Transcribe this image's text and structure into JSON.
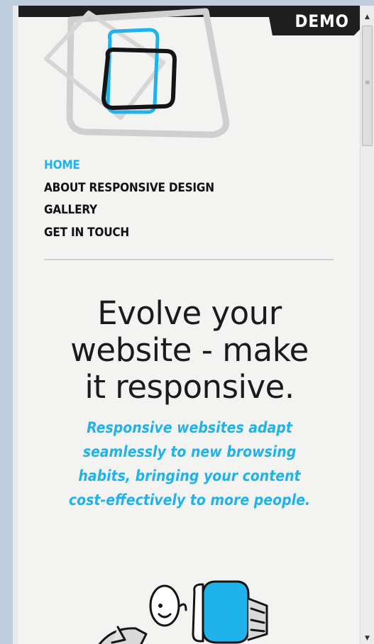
{
  "header": {
    "demo_label": "DEMO"
  },
  "nav": {
    "items": [
      {
        "label": "HOME",
        "active": true
      },
      {
        "label": "ABOUT RESPONSIVE DESIGN",
        "active": false
      },
      {
        "label": "GALLERY",
        "active": false
      },
      {
        "label": "GET IN TOUCH",
        "active": false
      }
    ]
  },
  "hero": {
    "headline_lines": [
      "Evolve your",
      "website - make",
      "it responsive."
    ],
    "tagline_lines": [
      "Responsive websites adapt",
      "seamlessly to new browsing",
      "habits, bringing your content",
      "cost-effectively to more people."
    ]
  },
  "colors": {
    "accent": "#1fb2eb",
    "dark": "#1f1f1f",
    "background": "#f3f3f2"
  },
  "icons": {
    "logo": "device-sketch-logo",
    "illustration": "cartoon-person-with-monitor",
    "scroll_up": "triangle-up-icon",
    "scroll_down": "triangle-down-icon"
  }
}
